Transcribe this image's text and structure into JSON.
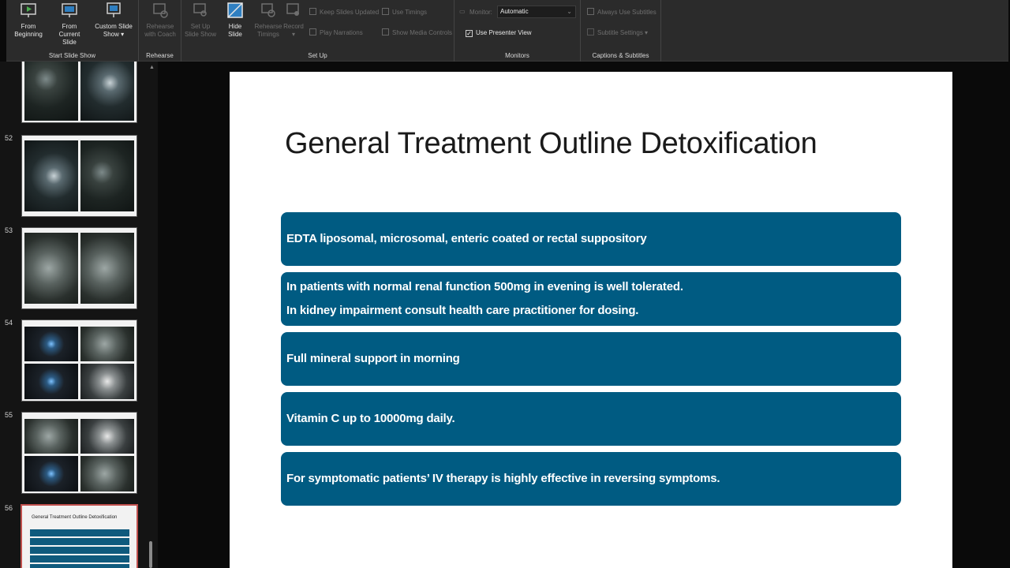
{
  "ribbon": {
    "start_slide_show": {
      "label": "Start Slide Show",
      "from_beginning": [
        "From",
        "Beginning"
      ],
      "from_current": [
        "From",
        "Current Slide"
      ],
      "custom_show": [
        "Custom Slide",
        "Show ▾"
      ]
    },
    "rehearse": {
      "label": "Rehearse",
      "rehearse_with_coach": [
        "Rehearse",
        "with Coach"
      ]
    },
    "setup": {
      "label": "Set Up",
      "setup_show": [
        "Set Up",
        "Slide Show"
      ],
      "hide_slide": [
        "Hide",
        "Slide"
      ],
      "rehearse_timings": [
        "Rehearse",
        "Timings"
      ],
      "record": [
        "Record",
        "▾"
      ],
      "keep_slides_updated": "Keep Slides Updated",
      "play_narrations": "Play Narrations",
      "use_timings": "Use Timings",
      "show_media_controls": "Show Media Controls"
    },
    "monitors": {
      "label": "Monitors",
      "monitor_label": "Monitor:",
      "monitor_value": "Automatic",
      "use_presenter_view": "Use Presenter View",
      "check_mark": "✓"
    },
    "captions": {
      "label": "Captions & Subtitles",
      "always_use_subtitles": "Always Use Subtitles",
      "subtitle_settings": "Subtitle Settings ▾"
    }
  },
  "thumbnails": {
    "numbers": [
      "52",
      "53",
      "54",
      "55",
      "56"
    ],
    "slide_56_title": "General Treatment Outline Detoxification"
  },
  "slide": {
    "title": "General Treatment Outline Detoxification",
    "items": [
      [
        "EDTA liposomal, microsomal, enteric coated or rectal suppository"
      ],
      [
        "In patients with normal renal function 500mg in evening is well tolerated.",
        "In kidney impairment consult health care practitioner for dosing."
      ],
      [
        "Full mineral support in morning"
      ],
      [
        "Vitamin C up to 10000mg daily."
      ],
      [
        "For symptomatic patients’ IV therapy is highly effective in reversing symptoms."
      ]
    ]
  },
  "colors": {
    "ribbon_bg": "#2b2b2b",
    "bar_fill": "#005b82",
    "selected_outline": "#c0504d"
  }
}
